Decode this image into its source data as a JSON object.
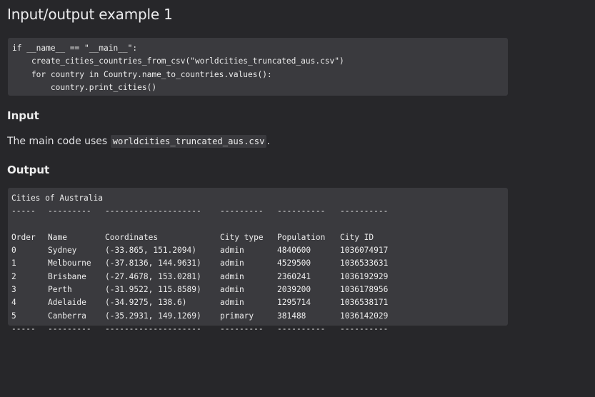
{
  "heading": "Input/output example 1",
  "code_lines": [
    "if __name__ == \"__main__\":",
    "    create_cities_countries_from_csv(\"worldcities_truncated_aus.csv\")",
    "    for country in Country.name_to_countries.values():",
    "        country.print_cities()"
  ],
  "input_heading": "Input",
  "input_text_before": "The main code uses ",
  "input_code": "worldcities_truncated_aus.csv",
  "input_text_after": ".",
  "output_heading": "Output",
  "output": {
    "title": "Cities of Australia",
    "separator": [
      "-----",
      "---------",
      "--------------------",
      "---------",
      "----------",
      "----------"
    ],
    "headers": [
      "Order",
      "Name",
      "Coordinates",
      "City type",
      "Population",
      "City ID"
    ],
    "rows": [
      [
        "0",
        "Sydney",
        "(-33.865, 151.2094)",
        "admin",
        "4840600",
        "1036074917"
      ],
      [
        "1",
        "Melbourne",
        "(-37.8136, 144.9631)",
        "admin",
        "4529500",
        "1036533631"
      ],
      [
        "2",
        "Brisbane",
        "(-27.4678, 153.0281)",
        "admin",
        "2360241",
        "1036192929"
      ],
      [
        "3",
        "Perth",
        "(-31.9522, 115.8589)",
        "admin",
        "2039200",
        "1036178956"
      ],
      [
        "4",
        "Adelaide",
        "(-34.9275, 138.6)",
        "admin",
        "1295714",
        "1036538171"
      ],
      [
        "5",
        "Canberra",
        "(-35.2931, 149.1269)",
        "primary",
        "381488",
        "1036142029"
      ]
    ]
  }
}
